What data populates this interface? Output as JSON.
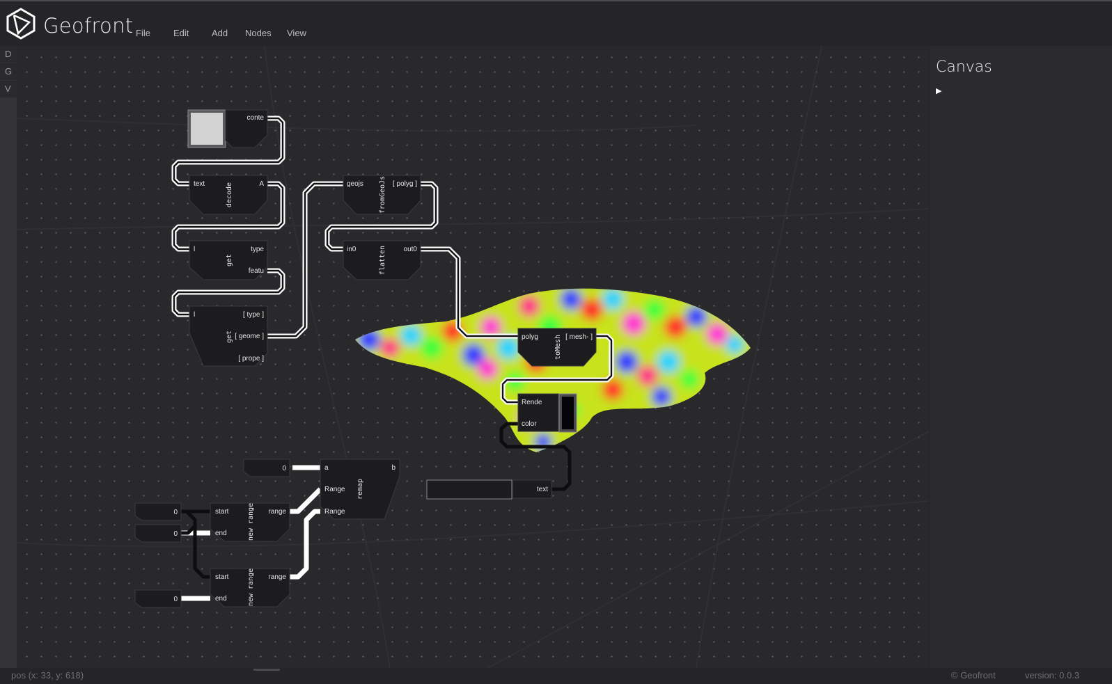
{
  "app": {
    "title": "Geofront",
    "menu": [
      "File",
      "Edit",
      "Add",
      "Nodes",
      "View"
    ]
  },
  "sidebar": {
    "tabs": [
      "D",
      "G",
      "V"
    ]
  },
  "panel": {
    "title": "Canvas",
    "toggle": "▶"
  },
  "status": {
    "pos": "pos (x: 33, y: 618)",
    "copyright": "© Geofront",
    "version": "version: 0.0.3"
  },
  "nodes": {
    "content_node": {
      "out": "conte"
    },
    "decode": {
      "title": "decode",
      "in": "text",
      "out": "A"
    },
    "get1": {
      "title": "get",
      "in": "l",
      "outs": [
        "type",
        "featu"
      ]
    },
    "get2": {
      "title": "get",
      "in": "l",
      "outs": [
        "[ type ]",
        "[ geome ]",
        "[ prope ]"
      ]
    },
    "fromGeoJs": {
      "title": "fromGeoJs",
      "in": "geojs",
      "out": "[ polyg ]"
    },
    "flatten": {
      "title": "flatten",
      "in": "in0",
      "out": "out0"
    },
    "toMesh": {
      "title": "toMesh",
      "in": "polyg",
      "out": "[ mesh- ]"
    },
    "render": {
      "ins": [
        "Rende",
        "color"
      ]
    },
    "text_node": {
      "out": "text",
      "value": ""
    },
    "remap": {
      "title": "remap",
      "ins": [
        "a",
        "Range",
        "Range"
      ],
      "out": "b"
    },
    "range1": {
      "title": "new range",
      "ins": [
        "start",
        "end"
      ],
      "out": "range"
    },
    "range2": {
      "title": "new range",
      "ins": [
        "start",
        "end"
      ],
      "out": "range"
    },
    "number_inputs": [
      "0",
      "0",
      "0",
      "0"
    ]
  },
  "colors": {
    "accent": "#ffffff",
    "background": "#29292c",
    "node_fill": "#1c1c1f"
  }
}
